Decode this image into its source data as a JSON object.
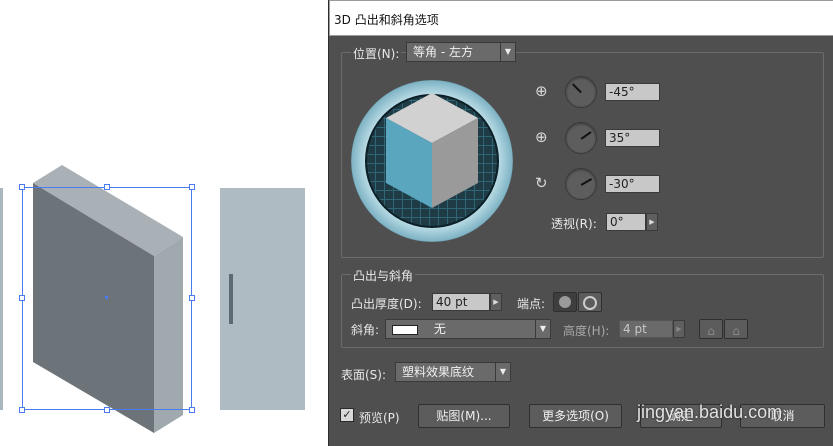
{
  "dialog": {
    "title": "3D 凸出和斜角选项",
    "position": {
      "label": "位置(N):",
      "value": "等角 - 左方",
      "x_rotation": "-45°",
      "y_rotation": "35°",
      "z_rotation": "-30°",
      "perspective_label": "透视(R):",
      "perspective_value": "0°"
    },
    "extrude": {
      "section_label": "凸出与斜角",
      "depth_label": "凸出厚度(D):",
      "depth_value": "40 pt",
      "cap_label": "端点:",
      "bevel_label": "斜角:",
      "bevel_value": "无",
      "height_label": "高度(H):",
      "height_value": "4 pt"
    },
    "surface": {
      "label": "表面(S):",
      "value": "塑料效果底纹"
    },
    "buttons": {
      "preview_label": "预览(P)",
      "map_label": "贴图(M)...",
      "more_label": "更多选项(O)",
      "ok_label": "确定",
      "cancel_label": "取消"
    }
  },
  "watermark": "jingyan.baidu.com"
}
